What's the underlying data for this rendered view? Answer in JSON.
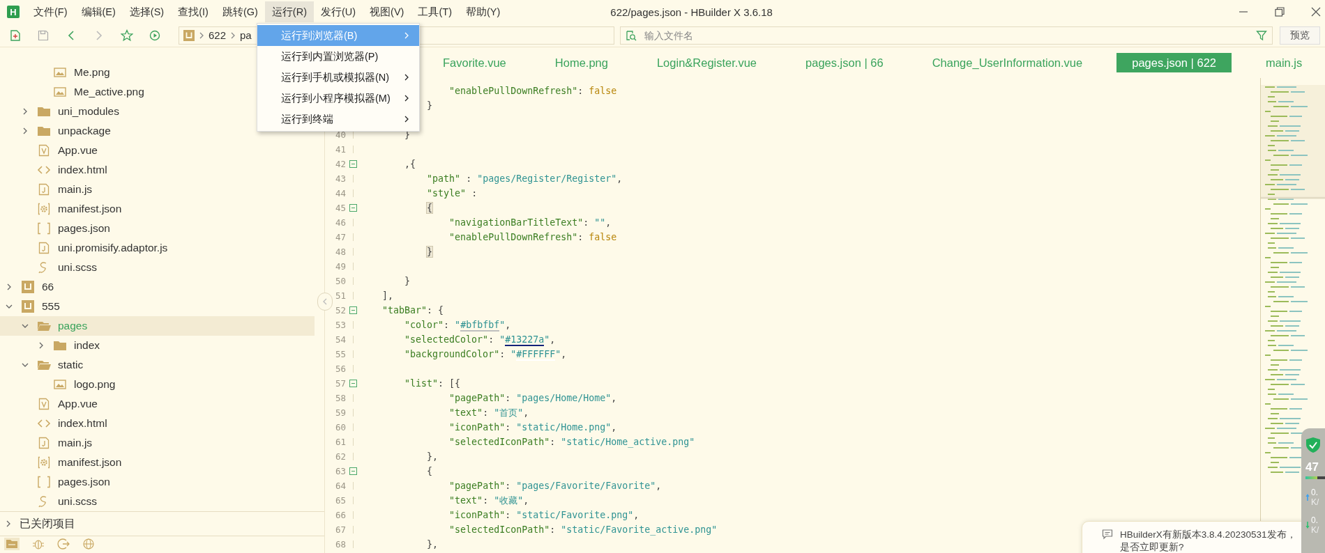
{
  "window": {
    "logo": "H",
    "title": "622/pages.json - HBuilder X 3.6.18"
  },
  "menubar": [
    {
      "label": "文件(F)",
      "selected": false
    },
    {
      "label": "编辑(E)",
      "selected": false
    },
    {
      "label": "选择(S)",
      "selected": false
    },
    {
      "label": "查找(I)",
      "selected": false
    },
    {
      "label": "跳转(G)",
      "selected": false
    },
    {
      "label": "运行(R)",
      "selected": true
    },
    {
      "label": "发行(U)",
      "selected": false
    },
    {
      "label": "视图(V)",
      "selected": false
    },
    {
      "label": "工具(T)",
      "selected": false
    },
    {
      "label": "帮助(Y)",
      "selected": false
    }
  ],
  "run_menu": [
    {
      "label": "运行到浏览器(B)",
      "submenu": true,
      "selected": true
    },
    {
      "label": "运行到内置浏览器(P)",
      "submenu": false,
      "selected": false
    },
    {
      "label": "运行到手机或模拟器(N)",
      "submenu": true,
      "selected": false
    },
    {
      "label": "运行到小程序模拟器(M)",
      "submenu": true,
      "selected": false
    },
    {
      "label": "运行到终端",
      "submenu": true,
      "selected": false
    }
  ],
  "toolbar": {
    "breadcrumb": [
      "622",
      "pa"
    ],
    "search": {
      "placeholder": "输入文件名"
    },
    "preview_button": "预览"
  },
  "tabs": [
    {
      "label": "Favorite.vue",
      "selected": false
    },
    {
      "label": "Home.png",
      "selected": false
    },
    {
      "label": "Login&Register.vue",
      "selected": false
    },
    {
      "label": "pages.json | 66",
      "selected": false
    },
    {
      "label": "Change_UserInformation.vue",
      "selected": false
    },
    {
      "label": "pages.json | 622",
      "selected": true
    },
    {
      "label": "main.js",
      "selected": false
    }
  ],
  "sidebar": {
    "tree": [
      {
        "children": [
          {
            "children": [
              {
                "label": "Me.png",
                "kind": "image",
                "selected": false
              },
              {
                "label": "Me_active.png",
                "kind": "image",
                "selected": false
              }
            ]
          },
          {
            "label": "uni_modules",
            "kind": "folder",
            "expanded": false,
            "selected": false
          },
          {
            "label": "unpackage",
            "kind": "folder",
            "expanded": false,
            "selected": false
          },
          {
            "label": "App.vue",
            "kind": "vue",
            "selected": false
          },
          {
            "label": "index.html",
            "kind": "html",
            "selected": false
          },
          {
            "label": "main.js",
            "kind": "js",
            "selected": false
          },
          {
            "label": "manifest.json",
            "kind": "manifest",
            "selected": false
          },
          {
            "label": "pages.json",
            "kind": "json",
            "selected": false
          },
          {
            "label": "uni.promisify.adaptor.js",
            "kind": "js",
            "selected": false
          },
          {
            "label": "uni.scss",
            "kind": "scss",
            "selected": false
          }
        ]
      },
      {
        "label": "66",
        "kind": "project",
        "expanded": false,
        "selected": false
      },
      {
        "label": "555",
        "kind": "project",
        "expanded": true,
        "selected": false,
        "children": [
          {
            "label": "pages",
            "kind": "folder",
            "expanded": true,
            "selected": true,
            "children": [
              {
                "label": "index",
                "kind": "folder",
                "expanded": false,
                "selected": false
              }
            ]
          },
          {
            "label": "static",
            "kind": "folder",
            "expanded": true,
            "selected": false,
            "children": [
              {
                "label": "logo.png",
                "kind": "image",
                "selected": false
              }
            ]
          },
          {
            "label": "App.vue",
            "kind": "vue",
            "selected": false
          },
          {
            "label": "index.html",
            "kind": "html",
            "selected": false
          },
          {
            "label": "main.js",
            "kind": "js",
            "selected": false
          },
          {
            "label": "manifest.json",
            "kind": "manifest",
            "selected": false
          },
          {
            "label": "pages.json",
            "kind": "json",
            "selected": false
          },
          {
            "label": "uni.scss",
            "kind": "scss",
            "selected": false
          }
        ]
      }
    ],
    "closed_projects": {
      "label": "已关闭项目",
      "expanded": false
    }
  },
  "editor": {
    "lines": [
      {
        "tokens": [
          {
            "kind": "key",
            "s": "                \"enablePullDownRefresh\""
          },
          {
            "kind": "punct",
            "s": ": "
          },
          {
            "kind": "bool",
            "s": "false"
          }
        ]
      },
      {
        "tokens": [
          {
            "kind": "punct",
            "s": "            }"
          }
        ]
      },
      {
        "kind": "blank"
      },
      {
        "number": "40",
        "fold": false,
        "tokens": [
          {
            "kind": "punct",
            "s": "        }"
          }
        ]
      },
      {
        "number": "41",
        "fold": false
      },
      {
        "number": "42",
        "fold": true,
        "tokens": [
          {
            "kind": "punct",
            "s": "        ,{"
          }
        ]
      },
      {
        "number": "43",
        "fold": false,
        "tokens": [
          {
            "kind": "key",
            "s": "            \"path\""
          },
          {
            "kind": "punct",
            "s": " : "
          },
          {
            "kind": "str",
            "s": "\"pages/Register/Register\""
          },
          {
            "kind": "punct",
            "s": ","
          }
        ]
      },
      {
        "number": "44",
        "fold": false,
        "tokens": [
          {
            "kind": "key",
            "s": "            \"style\""
          },
          {
            "kind": "punct",
            "s": " :"
          }
        ]
      },
      {
        "number": "45",
        "fold": true,
        "tokens": [
          {
            "kind": "match",
            "s": "            {"
          }
        ]
      },
      {
        "number": "46",
        "fold": false,
        "tokens": [
          {
            "kind": "key",
            "s": "                \"navigationBarTitleText\""
          },
          {
            "kind": "punct",
            "s": ": "
          },
          {
            "kind": "str",
            "s": "\"\""
          },
          {
            "kind": "punct",
            "s": ","
          }
        ]
      },
      {
        "number": "47",
        "fold": false,
        "tokens": [
          {
            "kind": "key",
            "s": "                \"enablePullDownRefresh\""
          },
          {
            "kind": "punct",
            "s": ": "
          },
          {
            "kind": "bool",
            "s": "false"
          }
        ]
      },
      {
        "number": "48",
        "fold": false,
        "tokens": [
          {
            "kind": "match",
            "s": "            }"
          }
        ]
      },
      {
        "number": "49",
        "fold": false
      },
      {
        "number": "50",
        "fold": false,
        "tokens": [
          {
            "kind": "punct",
            "s": "        }"
          }
        ]
      },
      {
        "number": "51",
        "fold": false,
        "tokens": [
          {
            "kind": "punct",
            "s": "    ],"
          }
        ]
      },
      {
        "number": "52",
        "fold": true,
        "tokens": [
          {
            "kind": "key",
            "s": "    \"tabBar\""
          },
          {
            "kind": "punct",
            "s": ": {"
          }
        ]
      },
      {
        "number": "53",
        "fold": false,
        "tokens": [
          {
            "kind": "key",
            "s": "        \"color\""
          },
          {
            "kind": "punct",
            "s": ": "
          },
          {
            "kind": "str",
            "s": "\""
          },
          {
            "kind": "color",
            "s": "#bfbfbf",
            "color": "#bfbfbf"
          },
          {
            "kind": "str",
            "s": "\""
          },
          {
            "kind": "punct",
            "s": ","
          }
        ]
      },
      {
        "number": "54",
        "fold": false,
        "tokens": [
          {
            "kind": "key",
            "s": "        \"selectedColor\""
          },
          {
            "kind": "punct",
            "s": ": "
          },
          {
            "kind": "str",
            "s": "\""
          },
          {
            "kind": "color",
            "s": "#13227a",
            "color": "#13227a"
          },
          {
            "kind": "str",
            "s": "\""
          },
          {
            "kind": "punct",
            "s": ","
          }
        ]
      },
      {
        "number": "55",
        "fold": false,
        "tokens": [
          {
            "kind": "key",
            "s": "        \"backgroundColor\""
          },
          {
            "kind": "punct",
            "s": ": "
          },
          {
            "kind": "str",
            "s": "\""
          },
          {
            "kind": "color",
            "s": "#FFFFFF",
            "color": "#ffffff"
          },
          {
            "kind": "str",
            "s": "\""
          },
          {
            "kind": "punct",
            "s": ","
          }
        ]
      },
      {
        "number": "56",
        "fold": false
      },
      {
        "number": "57",
        "fold": true,
        "tokens": [
          {
            "kind": "key",
            "s": "        \"list\""
          },
          {
            "kind": "punct",
            "s": ": [{"
          }
        ]
      },
      {
        "number": "58",
        "fold": false,
        "tokens": [
          {
            "kind": "key",
            "s": "                \"pagePath\""
          },
          {
            "kind": "punct",
            "s": ": "
          },
          {
            "kind": "str",
            "s": "\"pages/Home/Home\""
          },
          {
            "kind": "punct",
            "s": ","
          }
        ]
      },
      {
        "number": "59",
        "fold": false,
        "tokens": [
          {
            "kind": "key",
            "s": "                \"text\""
          },
          {
            "kind": "punct",
            "s": ": "
          },
          {
            "kind": "str",
            "s": "\"首页\""
          },
          {
            "kind": "punct",
            "s": ","
          }
        ]
      },
      {
        "number": "60",
        "fold": false,
        "tokens": [
          {
            "kind": "key",
            "s": "                \"iconPath\""
          },
          {
            "kind": "punct",
            "s": ": "
          },
          {
            "kind": "str",
            "s": "\"static/Home.png\""
          },
          {
            "kind": "punct",
            "s": ","
          }
        ]
      },
      {
        "number": "61",
        "fold": false,
        "tokens": [
          {
            "kind": "key",
            "s": "                \"selectedIconPath\""
          },
          {
            "kind": "punct",
            "s": ": "
          },
          {
            "kind": "str",
            "s": "\"static/Home_active.png\""
          }
        ]
      },
      {
        "number": "62",
        "fold": false,
        "tokens": [
          {
            "kind": "punct",
            "s": "            },"
          }
        ]
      },
      {
        "number": "63",
        "fold": true,
        "tokens": [
          {
            "kind": "punct",
            "s": "            {"
          }
        ]
      },
      {
        "number": "64",
        "fold": false,
        "tokens": [
          {
            "kind": "key",
            "s": "                \"pagePath\""
          },
          {
            "kind": "punct",
            "s": ": "
          },
          {
            "kind": "str",
            "s": "\"pages/Favorite/Favorite\""
          },
          {
            "kind": "punct",
            "s": ","
          }
        ]
      },
      {
        "number": "65",
        "fold": false,
        "tokens": [
          {
            "kind": "key",
            "s": "                \"text\""
          },
          {
            "kind": "punct",
            "s": ": "
          },
          {
            "kind": "str",
            "s": "\"收藏\""
          },
          {
            "kind": "punct",
            "s": ","
          }
        ]
      },
      {
        "number": "66",
        "fold": false,
        "tokens": [
          {
            "kind": "key",
            "s": "                \"iconPath\""
          },
          {
            "kind": "punct",
            "s": ": "
          },
          {
            "kind": "str",
            "s": "\"static/Favorite.png\""
          },
          {
            "kind": "punct",
            "s": ","
          }
        ]
      },
      {
        "number": "67",
        "fold": false,
        "tokens": [
          {
            "kind": "key",
            "s": "                \"selectedIconPath\""
          },
          {
            "kind": "punct",
            "s": ": "
          },
          {
            "kind": "str",
            "s": "\"static/Favorite_active.png\""
          }
        ]
      },
      {
        "number": "68",
        "fold": false,
        "tokens": [
          {
            "kind": "punct",
            "s": "            },"
          }
        ]
      }
    ]
  },
  "notification": {
    "text": "HBuilderX有新版本3.8.4.20230531发布，是否立即更新?"
  },
  "monitor": {
    "score": "47",
    "up": "0.",
    "up_unit": "K/",
    "down": "0.",
    "down_unit": "K/"
  }
}
